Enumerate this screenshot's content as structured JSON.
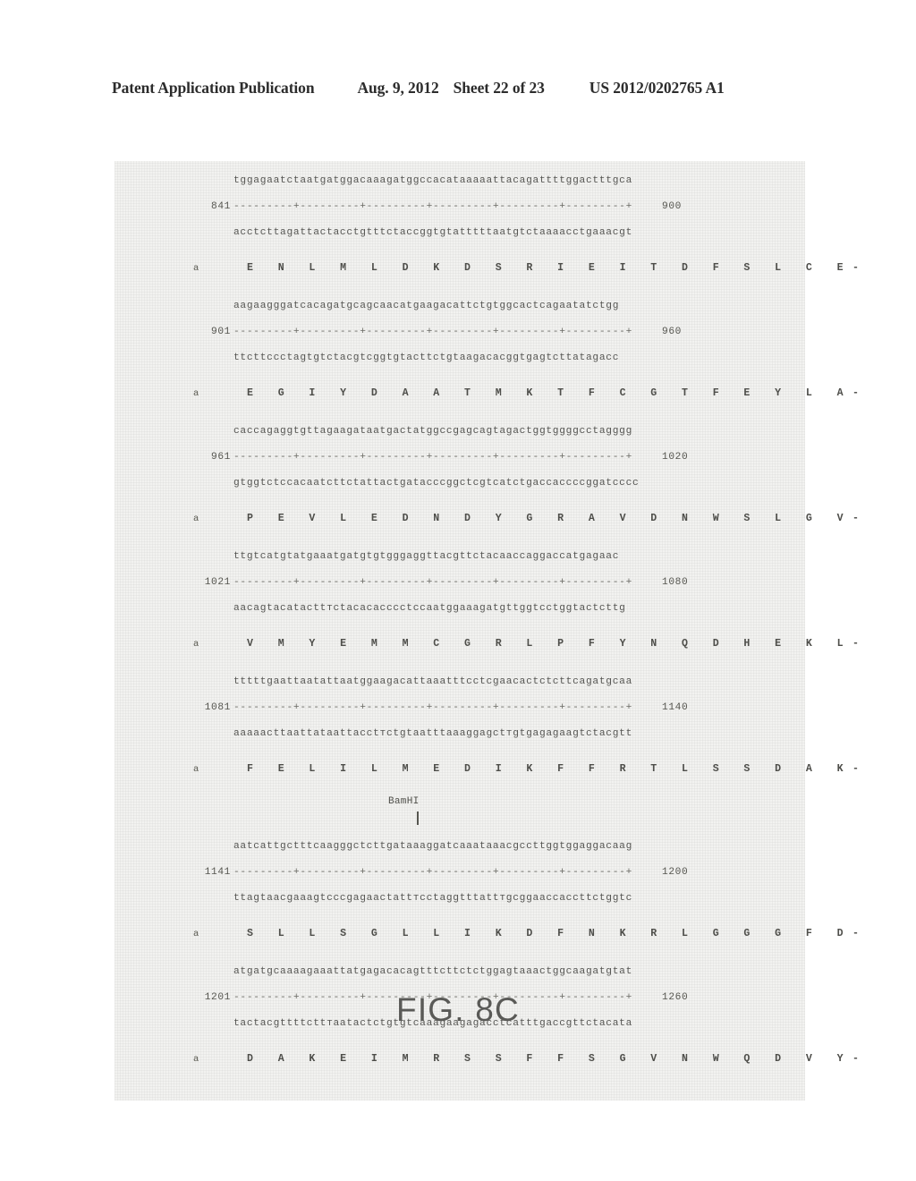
{
  "header": {
    "publication": "Patent Application Publication",
    "date": "Aug. 9, 2012",
    "sheet": "Sheet 22 of 23",
    "patent_number": "US 2012/0202765 A1"
  },
  "figure": {
    "caption": "FIG. 8C",
    "protein_marker": "a",
    "ruler_pattern": "---------+---------+---------+---------+---------+---------+",
    "annotation": {
      "enzyme": "BamHI"
    }
  },
  "blocks": [
    {
      "top_strand": "tggagaatctaatgatggacaaagatggccacataaaaattacagattttggactttgca",
      "pos_left": "841",
      "pos_right": "900",
      "bottom_strand": "acctcttagattactacctgtttctaccggtgtatttttaatgtctaaaacctgaaacgt",
      "protein": "E N L M L D K D S R I E I T D F S L C E-"
    },
    {
      "top_strand": "aagaagggatcacagatgcagcaacatgaagacattctgtggcactcagaatatctgg",
      "pos_left": "901",
      "pos_right": "960",
      "bottom_strand": "ttcttccctagtgtctacgtcggtgtacttctgtaagacacggtgagtcttatagacc",
      "protein": "E G I Y D A A T M K T F C G T F E Y L A-"
    },
    {
      "top_strand": "caccagaggtgttagaagataatgactatggccgagcagtagactggtggggcctagggg",
      "pos_left": "961",
      "pos_right": "1020",
      "bottom_strand": "gtggtctccacaatcttctattactgatacccggctcgtcatctgaccaccccggatcccc",
      "protein": "P E V L E D N D Y G R A V D N W S L G V-"
    },
    {
      "top_strand": "ttgtcatgtatgaaatgatgtgtgggaggttacgttctacaaccaggaccatgagaac",
      "pos_left": "1021",
      "pos_right": "1080",
      "bottom_strand": "aacagtacatacttтctacacacccctccaatggaaagatgttggtcctggtactcttg",
      "protein": "V M Y E M M C G R L P F Y N Q D H E K L-"
    },
    {
      "top_strand": "tttttgaattaatattaatggaagacattaaatttcctcgaacactctcttcagatgcaa",
      "pos_left": "1081",
      "pos_right": "1140",
      "bottom_strand": "aaaaacttaattataattacctтctgtaatttaaaggagctтgtgagagaagtctacgtt",
      "protein": "F E L I L M E D I K F F R T L S S D A K-"
    },
    {
      "top_strand": "aatcattgctttcaagggctcttgataaaggatcaaataaacgccttggtggaggacaag",
      "pos_left": "1141",
      "pos_right": "1200",
      "bottom_strand": "ttagtaacgaaagtcccgagaactattтcctaggtttattтgcggaaccaccttctggtc",
      "protein": "S L L S G L L I K D F N K R L G G G F D-"
    },
    {
      "top_strand": "atgatgcaaaagaaattatgagacacagtttcttctctggagtaaactggcaagatgtat",
      "pos_left": "1201",
      "pos_right": "1260",
      "bottom_strand": "tactacgttttcttтaatactctgtgtcaaagaagagacctcatttgaccgttctacata",
      "protein": "D A K E I M R S S F F S G V N W Q D V Y-"
    }
  ]
}
